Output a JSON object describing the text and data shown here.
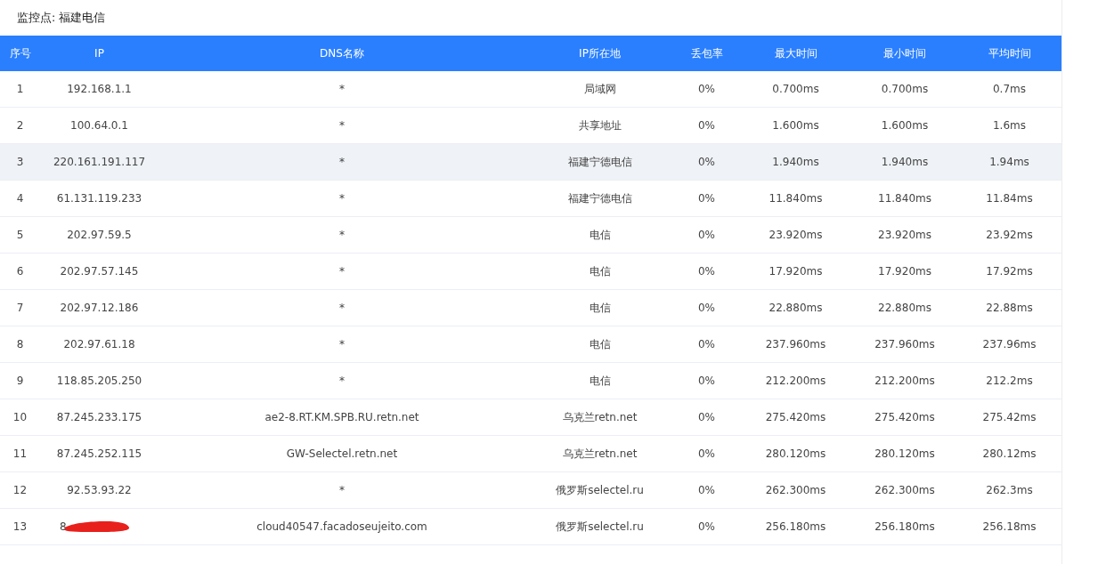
{
  "title": "监控点: 福建电信",
  "table": {
    "columns": [
      "序号",
      "IP",
      "DNS名称",
      "IP所在地",
      "丢包率",
      "最大时间",
      "最小时间",
      "平均时间"
    ],
    "rows": [
      {
        "highlighted": false,
        "cells": [
          "1",
          "192.168.1.1",
          "*",
          "局域网",
          "0%",
          "0.700ms",
          "0.700ms",
          "0.7ms"
        ]
      },
      {
        "highlighted": false,
        "cells": [
          "2",
          "100.64.0.1",
          "*",
          "共享地址",
          "0%",
          "1.600ms",
          "1.600ms",
          "1.6ms"
        ]
      },
      {
        "highlighted": true,
        "cells": [
          "3",
          "220.161.191.117",
          "*",
          "福建宁德电信",
          "0%",
          "1.940ms",
          "1.940ms",
          "1.94ms"
        ]
      },
      {
        "highlighted": false,
        "cells": [
          "4",
          "61.131.119.233",
          "*",
          "福建宁德电信",
          "0%",
          "11.840ms",
          "11.840ms",
          "11.84ms"
        ]
      },
      {
        "highlighted": false,
        "cells": [
          "5",
          "202.97.59.5",
          "*",
          "电信",
          "0%",
          "23.920ms",
          "23.920ms",
          "23.92ms"
        ]
      },
      {
        "highlighted": false,
        "cells": [
          "6",
          "202.97.57.145",
          "*",
          "电信",
          "0%",
          "17.920ms",
          "17.920ms",
          "17.92ms"
        ]
      },
      {
        "highlighted": false,
        "cells": [
          "7",
          "202.97.12.186",
          "*",
          "电信",
          "0%",
          "22.880ms",
          "22.880ms",
          "22.88ms"
        ]
      },
      {
        "highlighted": false,
        "cells": [
          "8",
          "202.97.61.18",
          "*",
          "电信",
          "0%",
          "237.960ms",
          "237.960ms",
          "237.96ms"
        ]
      },
      {
        "highlighted": false,
        "cells": [
          "9",
          "118.85.205.250",
          "*",
          "电信",
          "0%",
          "212.200ms",
          "212.200ms",
          "212.2ms"
        ]
      },
      {
        "highlighted": false,
        "cells": [
          "10",
          "87.245.233.175",
          "ae2-8.RT.KM.SPB.RU.retn.net",
          "乌克兰retn.net",
          "0%",
          "275.420ms",
          "275.420ms",
          "275.42ms"
        ]
      },
      {
        "highlighted": false,
        "cells": [
          "11",
          "87.245.252.115",
          "GW-Selectel.retn.net",
          "乌克兰retn.net",
          "0%",
          "280.120ms",
          "280.120ms",
          "280.12ms"
        ]
      },
      {
        "highlighted": false,
        "cells": [
          "12",
          "92.53.93.22",
          "*",
          "俄罗斯selectel.ru",
          "0%",
          "262.300ms",
          "262.300ms",
          "262.3ms"
        ]
      },
      {
        "highlighted": false,
        "redacted": true,
        "cells": [
          "13",
          "8",
          "cloud40547.facadoseujeito.com",
          "俄罗斯selectel.ru",
          "0%",
          "256.180ms",
          "256.180ms",
          "256.18ms"
        ]
      }
    ]
  }
}
